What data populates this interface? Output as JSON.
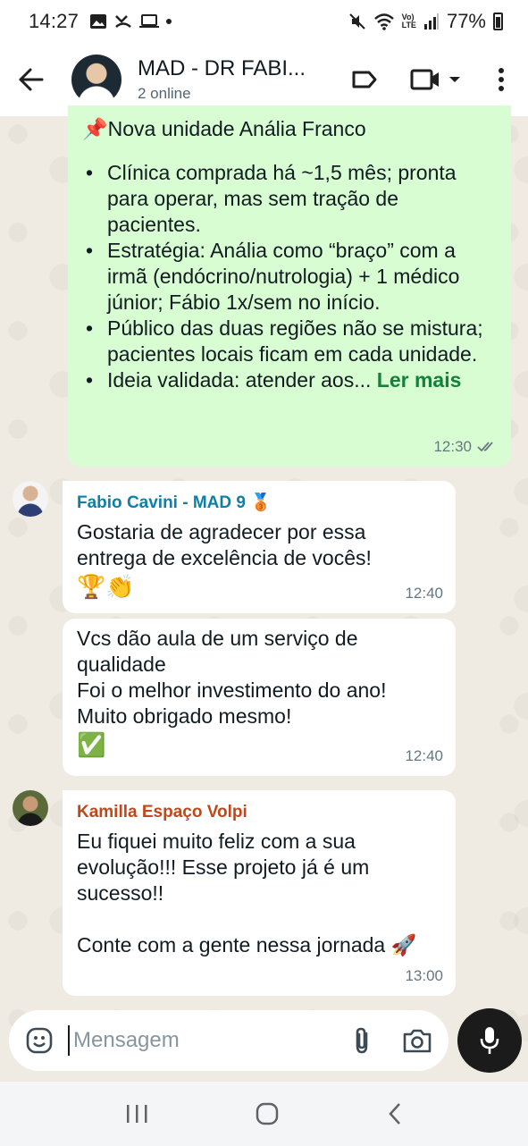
{
  "status_bar": {
    "time": "14:27",
    "battery": "77%",
    "network_label": "Vo)\nLTE"
  },
  "header": {
    "title": "MAD - DR FABI...",
    "subtitle": "2 online"
  },
  "messages": [
    {
      "type": "outgoing",
      "heading": "📌Nova unidade Anália Franco",
      "bullets": [
        "Clínica comprada há ~1,5 mês; pronta para operar, mas sem tração de pacientes.",
        "Estratégia: Anália como “braço” com a irmã (endócrino/nutrologia) + 1 médico júnior; Fábio 1x/sem no início.",
        "Público das duas regiões não se mistura; pacientes locais ficam em cada unidade.",
        "Ideia validada: atender aos..."
      ],
      "read_more": "Ler mais",
      "time": "12:30"
    },
    {
      "type": "incoming",
      "sender": "Fabio Cavini - MAD 9 🥉",
      "sender_color": "#0e7fa8",
      "lines": [
        "Gostaria de agradecer por essa",
        "entrega de excelência de vocês!",
        "🏆👏"
      ],
      "time": "12:40"
    },
    {
      "type": "incoming",
      "lines": [
        "Vcs dão aula de um serviço de",
        "qualidade",
        "Foi o melhor investimento do ano!",
        "Muito obrigado mesmo!",
        "✅"
      ],
      "time": "12:40"
    },
    {
      "type": "incoming",
      "sender": "Kamilla Espaço Volpi",
      "sender_color": "#c0471a",
      "lines": [
        "Eu fiquei muito feliz com a sua",
        "evolução!!! Esse projeto já é um",
        "sucesso!!",
        "",
        "Conte com a gente nessa jornada 🚀"
      ],
      "time": "13:00"
    }
  ],
  "composer": {
    "placeholder": "Mensagem"
  },
  "icons": {
    "back": "arrow-left-icon",
    "label": "label-icon",
    "video": "video-call-icon",
    "menu": "more-vert-icon",
    "emoji": "emoji-icon",
    "attach": "paperclip-icon",
    "camera": "camera-icon",
    "mic": "mic-icon"
  },
  "colors": {
    "outgoing_bubble": "#d9fdd3",
    "incoming_bubble": "#ffffff",
    "read_more": "#15803d",
    "chat_background": "#efeae2"
  }
}
